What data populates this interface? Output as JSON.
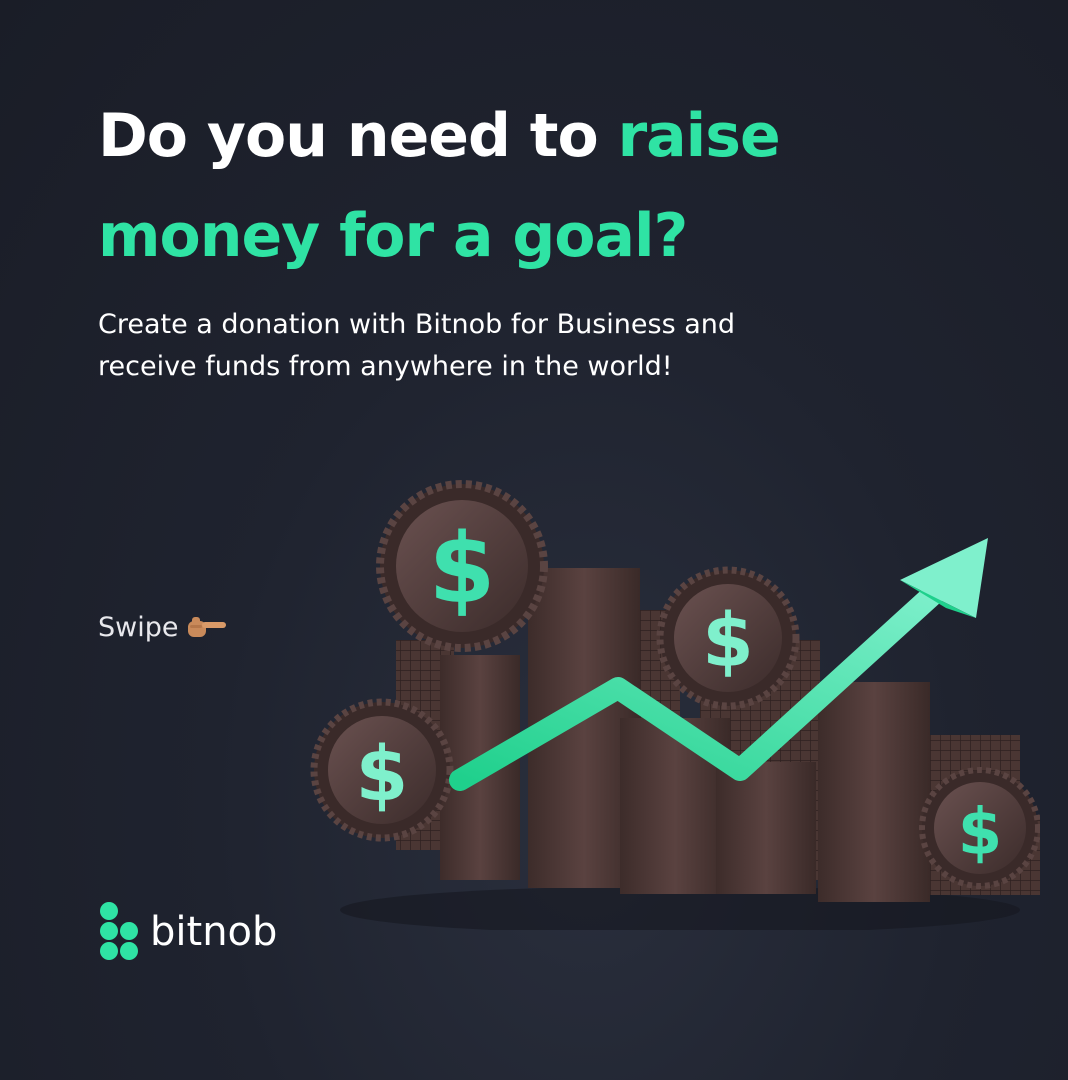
{
  "headline": {
    "part1": "Do you need to ",
    "accent1": "raise",
    "accent2": "money for a goal?"
  },
  "subtitle": {
    "line1": "Create a donation with Bitnob for Business and",
    "line2": "receive funds from anywhere in the world!"
  },
  "swipe": {
    "label": "Swipe",
    "icon": "pointing-hand-icon"
  },
  "brand": {
    "name": "bitnob",
    "logo": "bitnob-logo-icon"
  },
  "colors": {
    "accent": "#2fe3a4",
    "background": "#1f232f",
    "bar": "#4a3633"
  },
  "illustration": {
    "coin_symbol": "$",
    "icon": "growth-chart-illustration"
  }
}
